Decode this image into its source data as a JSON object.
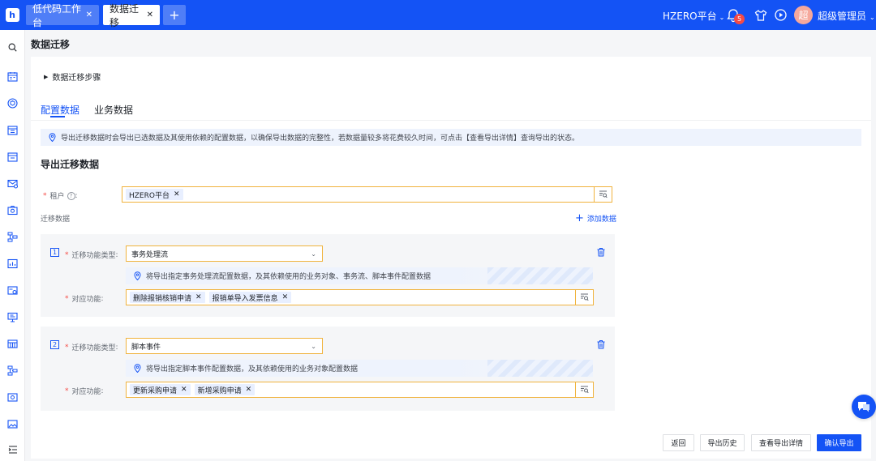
{
  "header": {
    "logo_text": "h",
    "tabs": [
      {
        "label": "低代码工作台"
      },
      {
        "label": "数据迁移"
      }
    ],
    "add_tab": "+",
    "platform": "HZERO平台",
    "notification_count": "5",
    "avatar_char": "超",
    "username": "超级管理员"
  },
  "page": {
    "title": "数据迁移",
    "steps_label": "数据迁移步骤",
    "subtabs": [
      {
        "label": "配置数据"
      },
      {
        "label": "业务数据"
      }
    ],
    "alert": "导出迁移数据时会导出已选数据及其使用依赖的配置数据，以确保导出数据的完整性，若数据量较多将花费较久时间，可点击【查看导出详情】查询导出的状态。",
    "section_title": "导出迁移数据",
    "tenant_label": "租户",
    "tenant_colon": ":",
    "tenant_tags": [
      "HZERO平台"
    ],
    "migration_label": "迁移数据",
    "add_data_label": "添加数据",
    "items": [
      {
        "index": "1",
        "type_label": "迁移功能类型",
        "type_value": "事务处理流",
        "hint": "将导出指定事务处理流配置数据，及其依赖使用的业务对象、事务流、脚本事件配置数据",
        "func_label": "对应功能",
        "func_tags": [
          "删除报销核销申请",
          "报销单导入发票信息"
        ]
      },
      {
        "index": "2",
        "type_label": "迁移功能类型",
        "type_value": "脚本事件",
        "hint": "将导出指定脚本事件配置数据，及其依赖使用的业务对象配置数据",
        "func_label": "对应功能",
        "func_tags": [
          "更新采购申请",
          "新增采购申请"
        ]
      }
    ]
  },
  "footer": {
    "back": "返回",
    "history": "导出历史",
    "details": "查看导出详情",
    "confirm": "确认导出"
  },
  "colors": {
    "primary": "#1453f5",
    "required_border": "#f0b33d",
    "tag_bg": "#e8efff",
    "alert_bg": "#eef3fd"
  }
}
